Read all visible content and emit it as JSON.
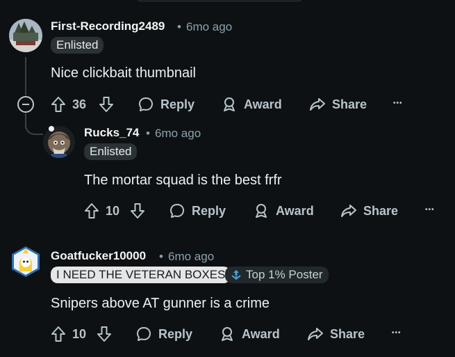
{
  "comments": [
    {
      "username": "First-Recording2489",
      "time": "6mo ago",
      "flair": "Enlisted",
      "text": "Nice clickbait thumbnail",
      "votes": "36",
      "reply_label": "Reply",
      "award_label": "Award",
      "share_label": "Share"
    },
    {
      "username": "Rucks_74",
      "time": "6mo ago",
      "flair": "Enlisted",
      "text": "The mortar squad is the best frfr",
      "votes": "10",
      "reply_label": "Reply",
      "award_label": "Award",
      "share_label": "Share"
    },
    {
      "username": "Goatfucker10000",
      "time": "6mo ago",
      "flair": "I NEED THE VETERAN BOXES",
      "badge": "Top 1% Poster",
      "text": "Snipers above AT gunner is a crime",
      "votes": "10",
      "reply_label": "Reply",
      "award_label": "Award",
      "share_label": "Share"
    }
  ],
  "separator": "•",
  "more_glyph": "•••",
  "icons": [
    "upvote-icon",
    "downvote-icon",
    "reply-icon",
    "award-icon",
    "share-icon",
    "more-icon",
    "collapse-icon"
  ]
}
